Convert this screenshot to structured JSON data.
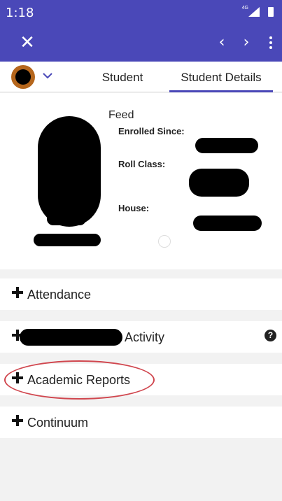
{
  "status_bar": {
    "time": "1:18",
    "network": "4G"
  },
  "app_bar": {
    "close_icon": "close-icon",
    "prev_icon": "chevron-left-icon",
    "next_icon": "chevron-right-icon",
    "menu_icon": "more-vert-icon"
  },
  "tabs": [
    {
      "label": "Student",
      "selected": false
    },
    {
      "label": "Student Details",
      "selected": true
    }
  ],
  "profile": {
    "feed_label": "Feed",
    "enrolled_label": "Enrolled Since:",
    "roll_class_label": "Roll Class:",
    "house_label": "House:"
  },
  "sections": [
    {
      "label": "Attendance"
    },
    {
      "label": "Activity",
      "has_help": true
    },
    {
      "label": "Academic Reports",
      "highlighted": true
    },
    {
      "label": "Continuum"
    }
  ],
  "colors": {
    "primary": "#4a48b8",
    "highlight_circle": "#d0464e",
    "avatar_ring": "#b5661c"
  }
}
